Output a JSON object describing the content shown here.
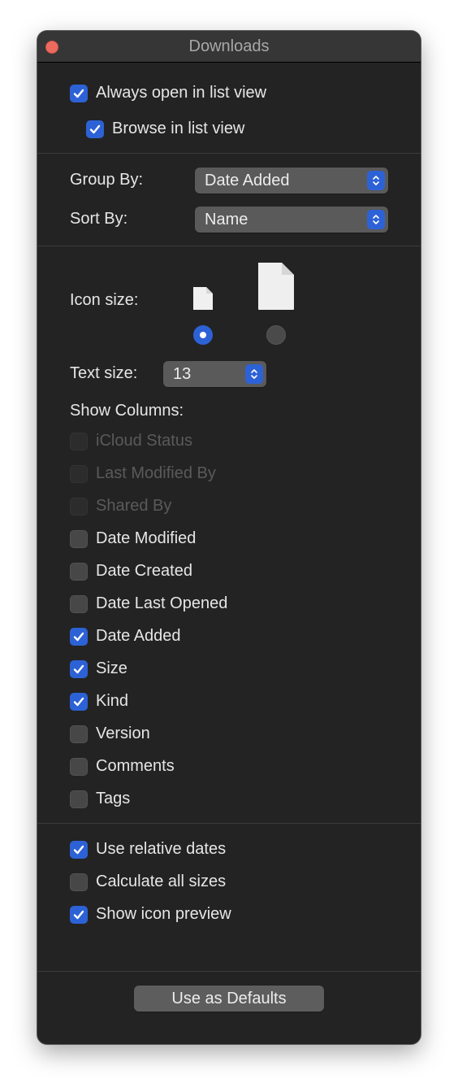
{
  "window": {
    "title": "Downloads"
  },
  "top_options": [
    {
      "label": "Always open in list view",
      "checked": true
    },
    {
      "label": "Browse in list view",
      "checked": true
    }
  ],
  "group_by": {
    "label": "Group By:",
    "value": "Date Added"
  },
  "sort_by": {
    "label": "Sort By:",
    "value": "Name"
  },
  "icon_size": {
    "label": "Icon size:",
    "selected": "small",
    "options": [
      "small",
      "large"
    ]
  },
  "text_size": {
    "label": "Text size:",
    "value": "13"
  },
  "show_columns": {
    "label": "Show Columns:",
    "items": [
      {
        "label": "iCloud Status",
        "checked": false,
        "enabled": false
      },
      {
        "label": "Last Modified By",
        "checked": false,
        "enabled": false
      },
      {
        "label": "Shared By",
        "checked": false,
        "enabled": false
      },
      {
        "label": "Date Modified",
        "checked": false,
        "enabled": true
      },
      {
        "label": "Date Created",
        "checked": false,
        "enabled": true
      },
      {
        "label": "Date Last Opened",
        "checked": false,
        "enabled": true
      },
      {
        "label": "Date Added",
        "checked": true,
        "enabled": true
      },
      {
        "label": "Size",
        "checked": true,
        "enabled": true
      },
      {
        "label": "Kind",
        "checked": true,
        "enabled": true
      },
      {
        "label": "Version",
        "checked": false,
        "enabled": true
      },
      {
        "label": "Comments",
        "checked": false,
        "enabled": true
      },
      {
        "label": "Tags",
        "checked": false,
        "enabled": true
      }
    ]
  },
  "bottom_options": [
    {
      "label": "Use relative dates",
      "checked": true
    },
    {
      "label": "Calculate all sizes",
      "checked": false
    },
    {
      "label": "Show icon preview",
      "checked": true
    }
  ],
  "defaults_button": {
    "label": "Use as Defaults"
  },
  "colors": {
    "accent": "#2d62d6",
    "window_bg": "#232323",
    "close": "#ed6a5e"
  }
}
